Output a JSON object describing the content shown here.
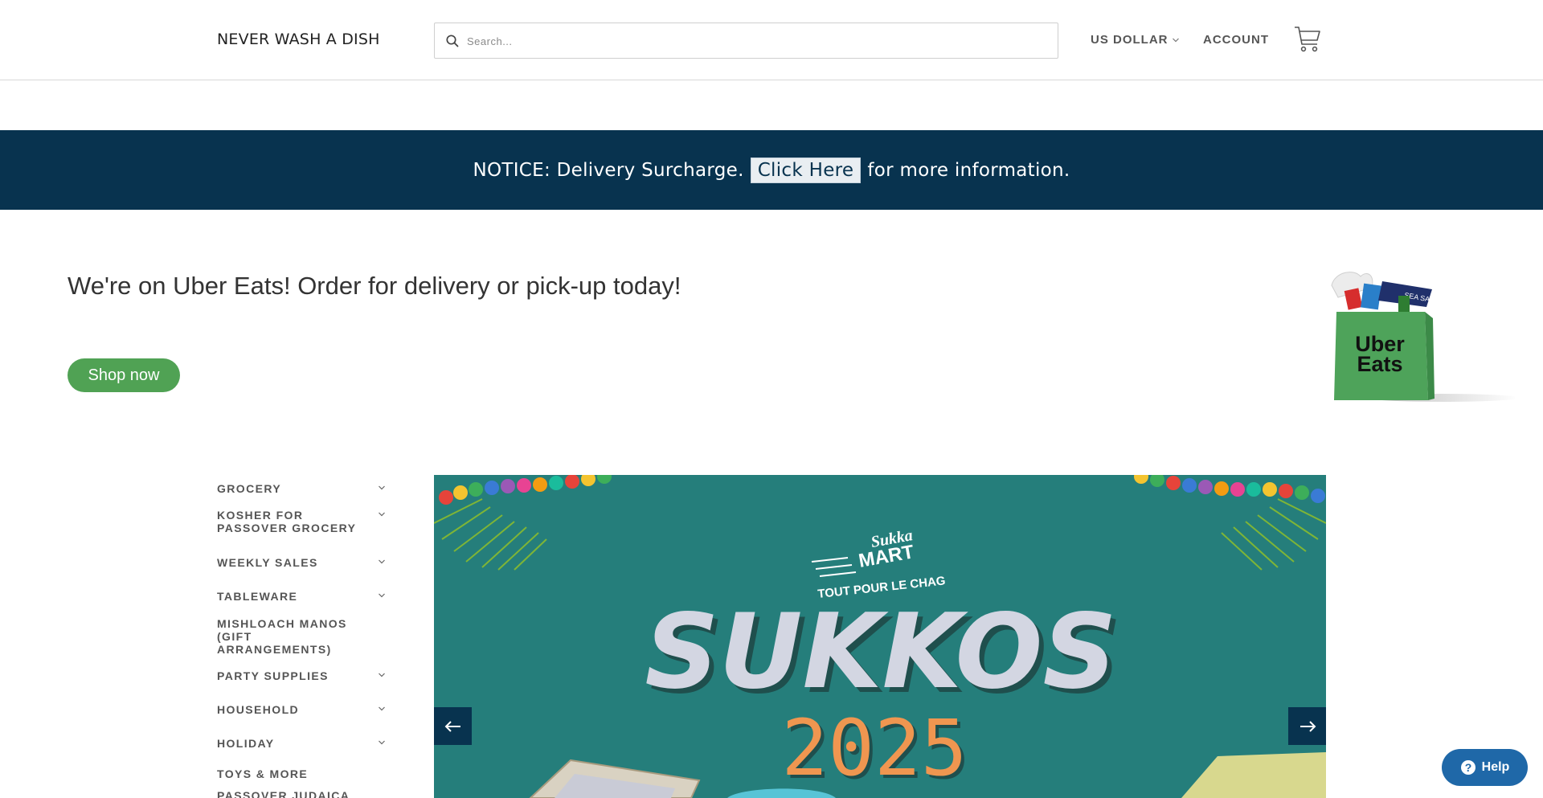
{
  "header": {
    "logo": "NEVER WASH A DISH",
    "search_placeholder": "Search...",
    "currency": "US DOLLAR",
    "account": "ACCOUNT"
  },
  "notice": {
    "prefix": "NOTICE: Delivery Surcharge.",
    "link": "Click Here",
    "suffix": "for more information."
  },
  "promo": {
    "headline": "We're on Uber Eats! Order for delivery or pick-up today!",
    "button": "Shop now",
    "bag_text_1": "Uber",
    "bag_text_2": "Eats"
  },
  "sidebar": {
    "items": [
      {
        "line1": "GROCERY",
        "line2": "",
        "chevron": true
      },
      {
        "line1": "KOSHER FOR",
        "line2": "PASSOVER GROCERY",
        "chevron": true
      },
      {
        "line1": "WEEKLY SALES",
        "line2": "",
        "chevron": true
      },
      {
        "line1": "TABLEWARE",
        "line2": "",
        "chevron": true
      },
      {
        "line1": "MISHLOACH MANOS (GIFT",
        "line2": "ARRANGEMENTS)",
        "chevron": false
      },
      {
        "line1": "PARTY SUPPLIES",
        "line2": "",
        "chevron": true
      },
      {
        "line1": "HOUSEHOLD",
        "line2": "",
        "chevron": true
      },
      {
        "line1": "HOLIDAY",
        "line2": "",
        "chevron": true
      },
      {
        "line1": "TOYS & MORE",
        "line2": "",
        "chevron": false
      },
      {
        "line1": "PASSOVER JUDAICA",
        "line2": "",
        "chevron": false
      }
    ]
  },
  "slide": {
    "brand_top": "Sukka",
    "brand_mid": "MART",
    "tagline": "TOUT POUR LE CHAG",
    "title": "SUKKOS",
    "year": "2025"
  },
  "help": {
    "label": "Help"
  },
  "colors": {
    "notice_bg": "#08334f",
    "shop_button": "#50a254",
    "slide_bg": "#257e7b",
    "year": "#ef9650",
    "help_bg": "#1f68a8"
  }
}
